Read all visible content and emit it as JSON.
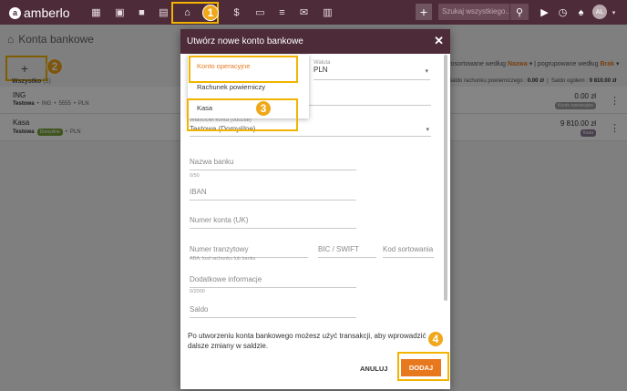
{
  "topbar": {
    "logo": "amberlo",
    "search_placeholder": "Szukaj wszystkiego...",
    "avatar_initials": "AL",
    "nav_icons": [
      "dashboard-icon",
      "contacts-icon",
      "briefcase-icon",
      "document-icon",
      "bank-icon",
      "money-icon",
      "folder-icon",
      "notes-icon",
      "mail-icon",
      "reports-icon"
    ]
  },
  "page": {
    "title": "Konta bankowe",
    "add_label": "+",
    "tab_all": "Wszystko",
    "tab_all_count": "(3)",
    "sort_label": "Posortowane według",
    "sort_value": "Nazwa",
    "group_label": "pogrupowane według",
    "group_value": "Brak",
    "total_trust_label": "Saldo rachunku powierniczego :",
    "total_trust_value": "0.00 zł",
    "total_label": "Saldo ogółem :",
    "total_value": "9 810.00 zł"
  },
  "accounts": [
    {
      "name": "ING",
      "owner": "Testowa",
      "bank": "ING",
      "number": "5555",
      "currency": "PLN",
      "default": "",
      "amount": "0.00 zł",
      "type": "Konto operacyjne",
      "type_color": "#a0a0a0"
    },
    {
      "name": "Kasa",
      "owner": "Testowa",
      "bank": "",
      "number": "",
      "currency": "PLN",
      "default": "Domyślne",
      "amount": "9 810.00 zł",
      "type": "Kasa",
      "type_color": "#8a7a95"
    }
  ],
  "modal": {
    "title": "Utwórz nowe konto bankowe",
    "close": "✕",
    "currency_label": "Waluta",
    "currency_value": "PLN",
    "owner_label": "Właściciel konta (oddział)",
    "owner_value": "Testowa (Domyślne)",
    "bank_name_label": "Nazwa banku",
    "bank_name_counter": "0/50",
    "iban_label": "IBAN",
    "account_number_label": "Numer konta (UK)",
    "transit_label": "Numer tranzytowy",
    "transit_hint": "ABA, kod rachunku lub banku",
    "bic_label": "BIC / SWIFT",
    "sort_code_label": "Kod sortowania",
    "additional_label": "Dodatkowe informacje",
    "additional_counter": "0/2000",
    "balance_label": "Saldo",
    "info": "Po utworzeniu konta bankowego możesz użyć transakcji, aby wprowadzić dalsze zmiany w saldzie.",
    "cancel": "ANULUJ",
    "add": "DODAJ"
  },
  "dropdown": {
    "options": [
      "Konto operacyjne",
      "Rachunek powierniczy",
      "Kasa"
    ],
    "selected": "Konto operacyjne"
  },
  "callouts": [
    "1",
    "2",
    "3",
    "4"
  ],
  "colors": {
    "brand": "#4d2b38",
    "accent": "#e8781e",
    "callout": "#f0a719",
    "highlight": "#f2b400"
  }
}
